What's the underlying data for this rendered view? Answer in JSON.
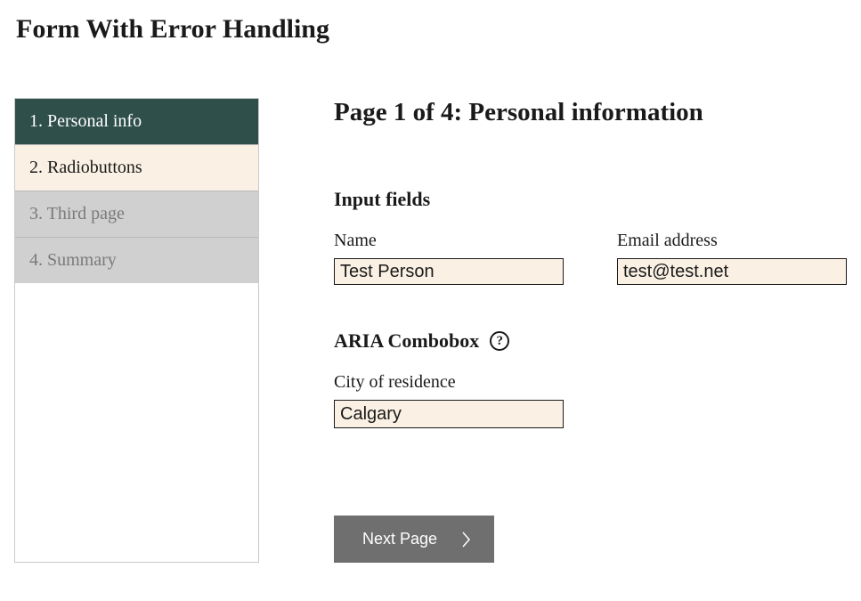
{
  "pageTitle": "Form With Error Handling",
  "sidebar": {
    "items": [
      {
        "label": "1. Personal info",
        "state": "active"
      },
      {
        "label": "2. Radiobuttons",
        "state": "next"
      },
      {
        "label": "3. Third page",
        "state": "disabled"
      },
      {
        "label": "4. Summary",
        "state": "disabled"
      }
    ]
  },
  "main": {
    "heading": "Page 1 of 4: Personal information",
    "section1": {
      "title": "Input fields",
      "name": {
        "label": "Name",
        "value": "Test Person"
      },
      "email": {
        "label": "Email address",
        "value": "test@test.net"
      }
    },
    "section2": {
      "title": "ARIA Combobox",
      "help": "?",
      "city": {
        "label": "City of residence",
        "value": "Calgary"
      }
    },
    "nextButton": "Next Page"
  }
}
